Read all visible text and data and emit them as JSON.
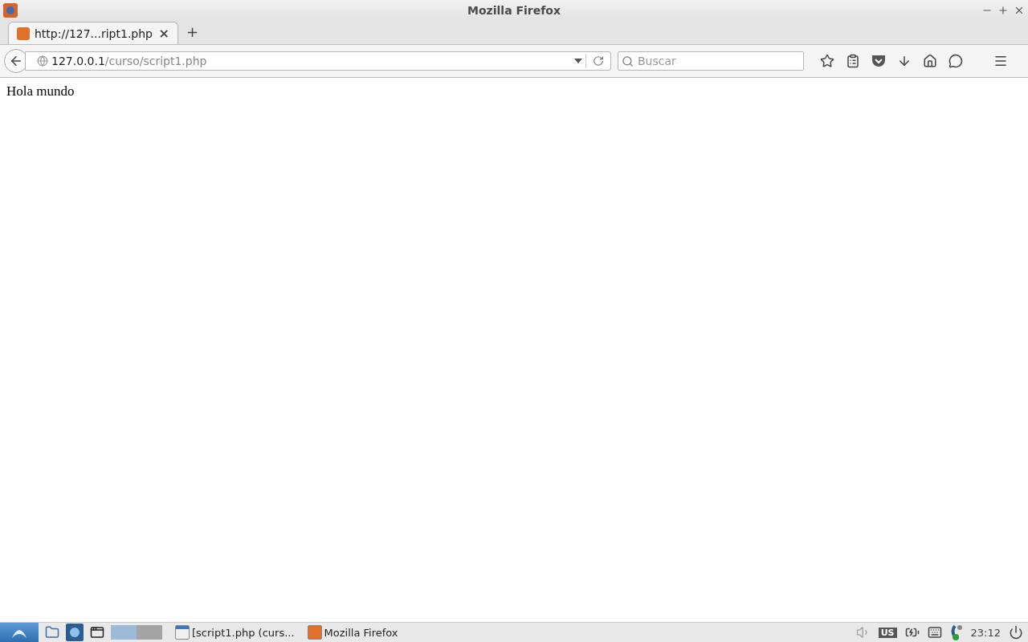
{
  "window": {
    "title": "Mozilla Firefox"
  },
  "tabs": [
    {
      "label": "http://127...ript1.php",
      "selected": true,
      "close": "×"
    }
  ],
  "new_tab": "+",
  "address": {
    "host": "127.0.0.1",
    "path": "/curso/script1.php"
  },
  "search": {
    "placeholder": "Buscar"
  },
  "content": {
    "text": "Hola mundo"
  },
  "taskbar": {
    "workspaces": [
      {
        "selected": true
      },
      {
        "selected": false
      }
    ],
    "tasks": [
      {
        "label": "[script1.php (curs...",
        "kind": "window"
      },
      {
        "label": "Mozilla Firefox",
        "kind": "firefox"
      }
    ],
    "layout": "US",
    "clock": "23:12"
  }
}
